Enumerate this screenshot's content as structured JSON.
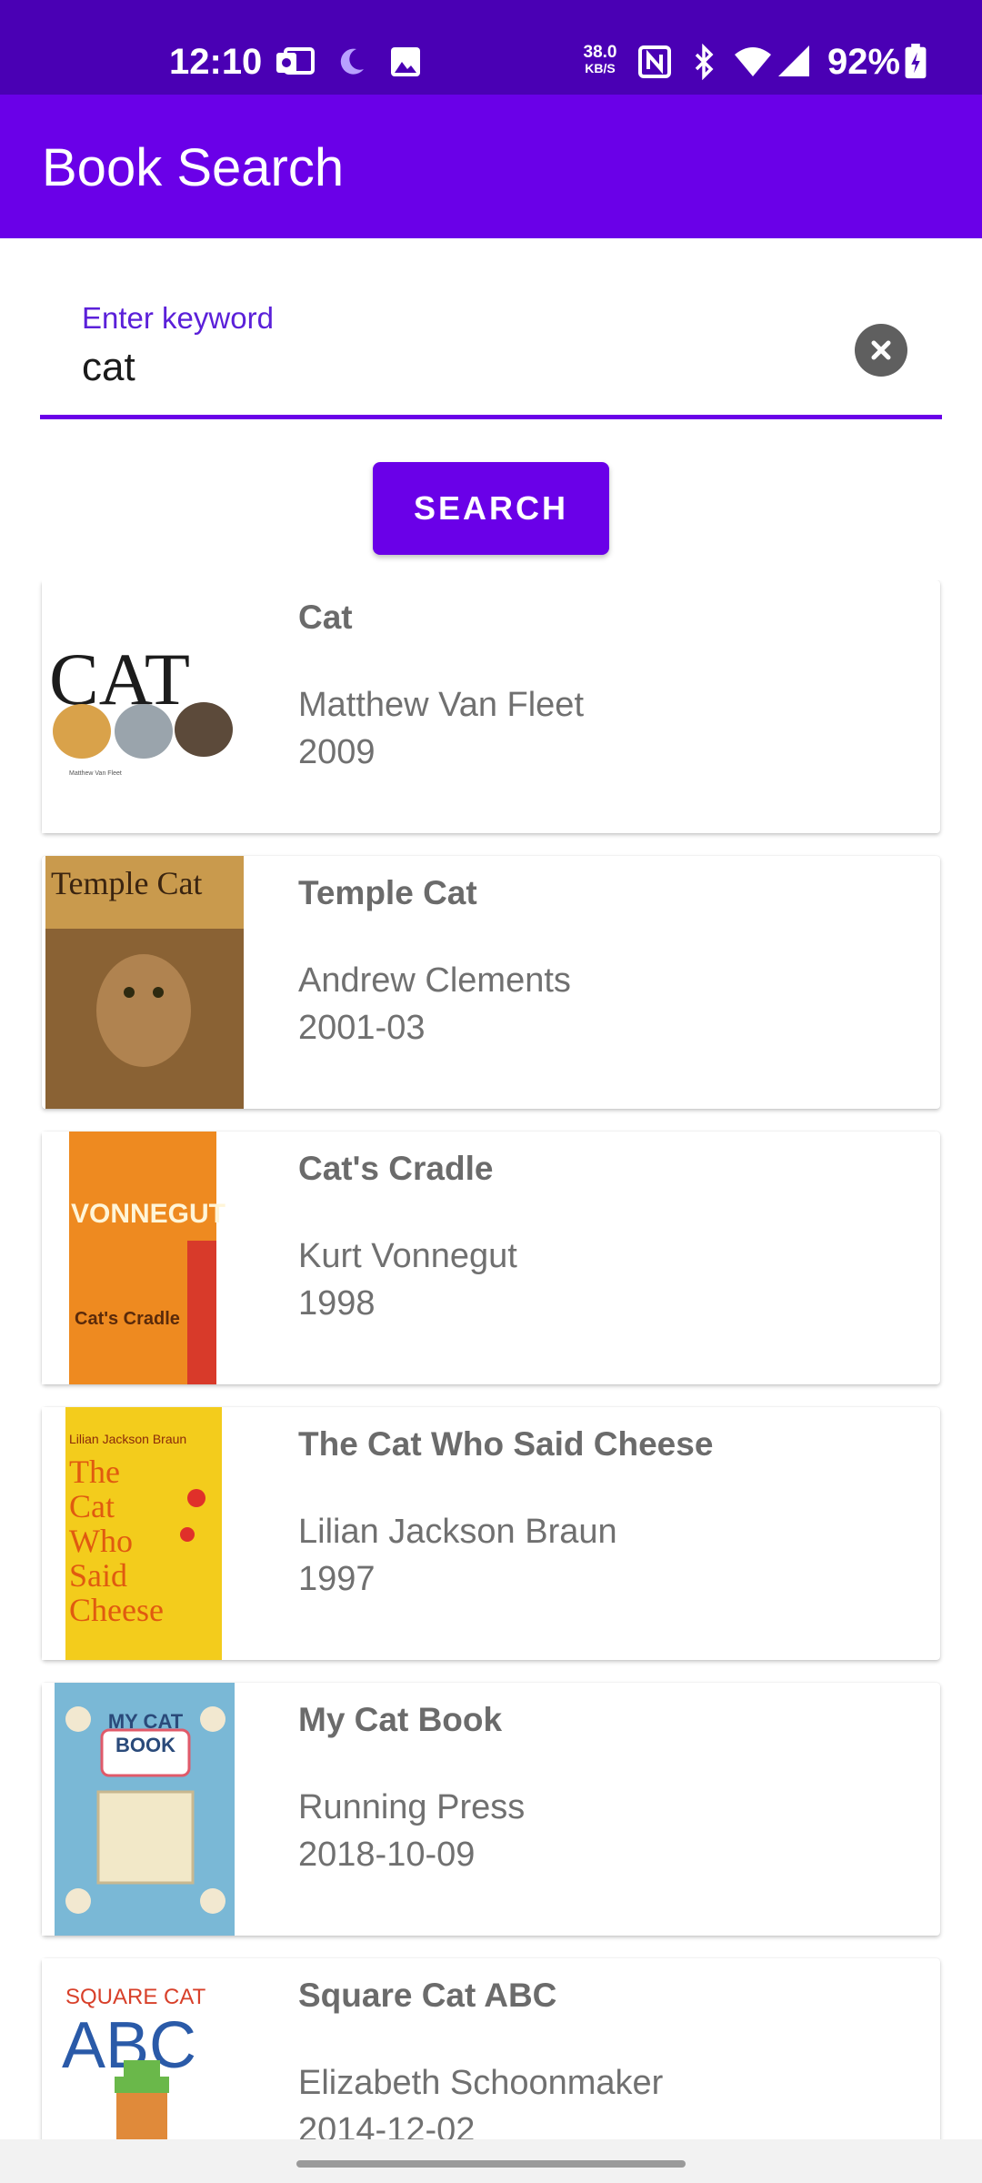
{
  "status_bar": {
    "time": "12:10",
    "net_speed_value": "38.0",
    "net_speed_unit": "KB/S",
    "battery": "92%",
    "icons": [
      "outlook-icon",
      "moon-icon",
      "image-icon",
      "nfc-icon",
      "bluetooth-icon",
      "wifi-icon",
      "signal-icon",
      "battery-charging-icon"
    ]
  },
  "app_bar": {
    "title": "Book Search"
  },
  "search": {
    "label": "Enter keyword",
    "value": "cat",
    "button_label": "SEARCH"
  },
  "results": [
    {
      "title": "Cat",
      "author": "Matthew Van Fleet",
      "date": "2009"
    },
    {
      "title": "Temple Cat",
      "author": "Andrew Clements",
      "date": "2001-03"
    },
    {
      "title": "Cat's Cradle",
      "author": "Kurt Vonnegut",
      "date": "1998"
    },
    {
      "title": "The Cat Who Said Cheese",
      "author": "Lilian Jackson Braun",
      "date": "1997"
    },
    {
      "title": "My Cat Book",
      "author": "Running Press",
      "date": "2018-10-09"
    },
    {
      "title": "Square Cat ABC",
      "author": "Elizabeth Schoonmaker",
      "date": "2014-12-02"
    }
  ],
  "covers": [
    {
      "text": "CAT",
      "sub": "Matthew Van Fleet"
    },
    {
      "text": "Temple Cat"
    },
    {
      "text": "VONNEGUT",
      "sub": "Cat's Cradle"
    },
    {
      "text": "The Cat Who Said Cheese",
      "sub": "Lilian Jackson Braun"
    },
    {
      "text": "MY CAT BOOK"
    },
    {
      "text": "SQUARE CAT",
      "sub": "ABC"
    }
  ],
  "colors": {
    "status_bar": "#4a00b4",
    "primary": "#6a00e8",
    "label": "#5b20d9"
  }
}
